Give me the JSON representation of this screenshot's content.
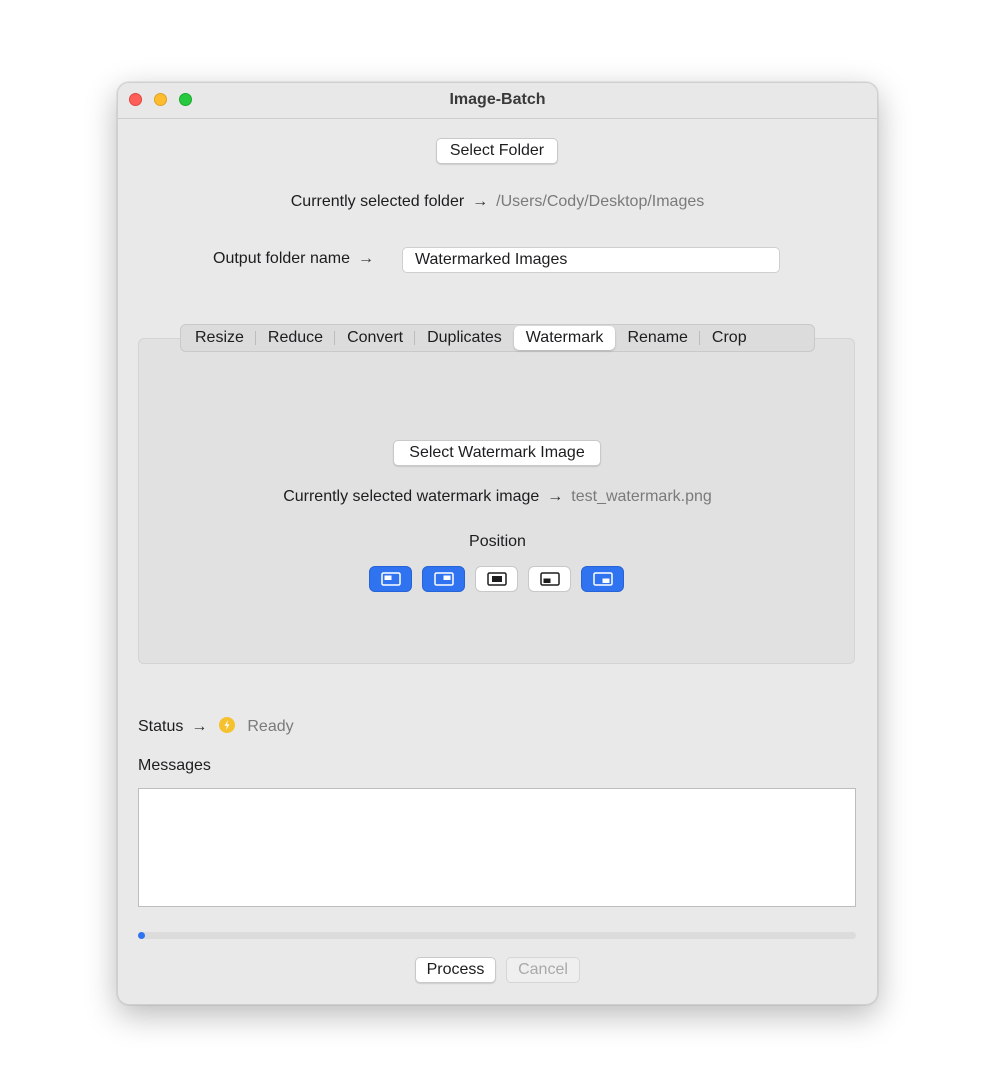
{
  "window": {
    "title": "Image-Batch"
  },
  "folder": {
    "select_button": "Select Folder",
    "selected_label": "Currently selected folder",
    "selected_path": "/Users/Cody/Desktop/Images",
    "arrow": "→"
  },
  "output": {
    "label": "Output folder name",
    "value": "Watermarked Images",
    "arrow": "→"
  },
  "tabs": {
    "items": [
      "Resize",
      "Reduce",
      "Convert",
      "Duplicates",
      "Watermark",
      "Rename",
      "Crop"
    ],
    "active": "Watermark"
  },
  "watermark": {
    "select_button": "Select Watermark Image",
    "selected_label": "Currently selected watermark image",
    "selected_file": "test_watermark.png",
    "arrow": "→",
    "position_label": "Position",
    "positions": [
      {
        "icon": "top-left-position-icon",
        "selected": true
      },
      {
        "icon": "top-right-position-icon",
        "selected": true
      },
      {
        "icon": "center-position-icon",
        "selected": false
      },
      {
        "icon": "bottom-left-position-icon",
        "selected": false
      },
      {
        "icon": "bottom-right-position-icon",
        "selected": true
      }
    ]
  },
  "status": {
    "label": "Status",
    "arrow": "→",
    "icon": "lightning-bolt-icon",
    "value": "Ready"
  },
  "messages": {
    "label": "Messages",
    "content": ""
  },
  "progress": {
    "value": 0
  },
  "actions": {
    "process_label": "Process",
    "cancel_label": "Cancel",
    "cancel_enabled": false
  },
  "colors": {
    "accent": "#2f73f0",
    "status_icon": "#f5c12e",
    "window_bg": "#e9e9e9"
  }
}
